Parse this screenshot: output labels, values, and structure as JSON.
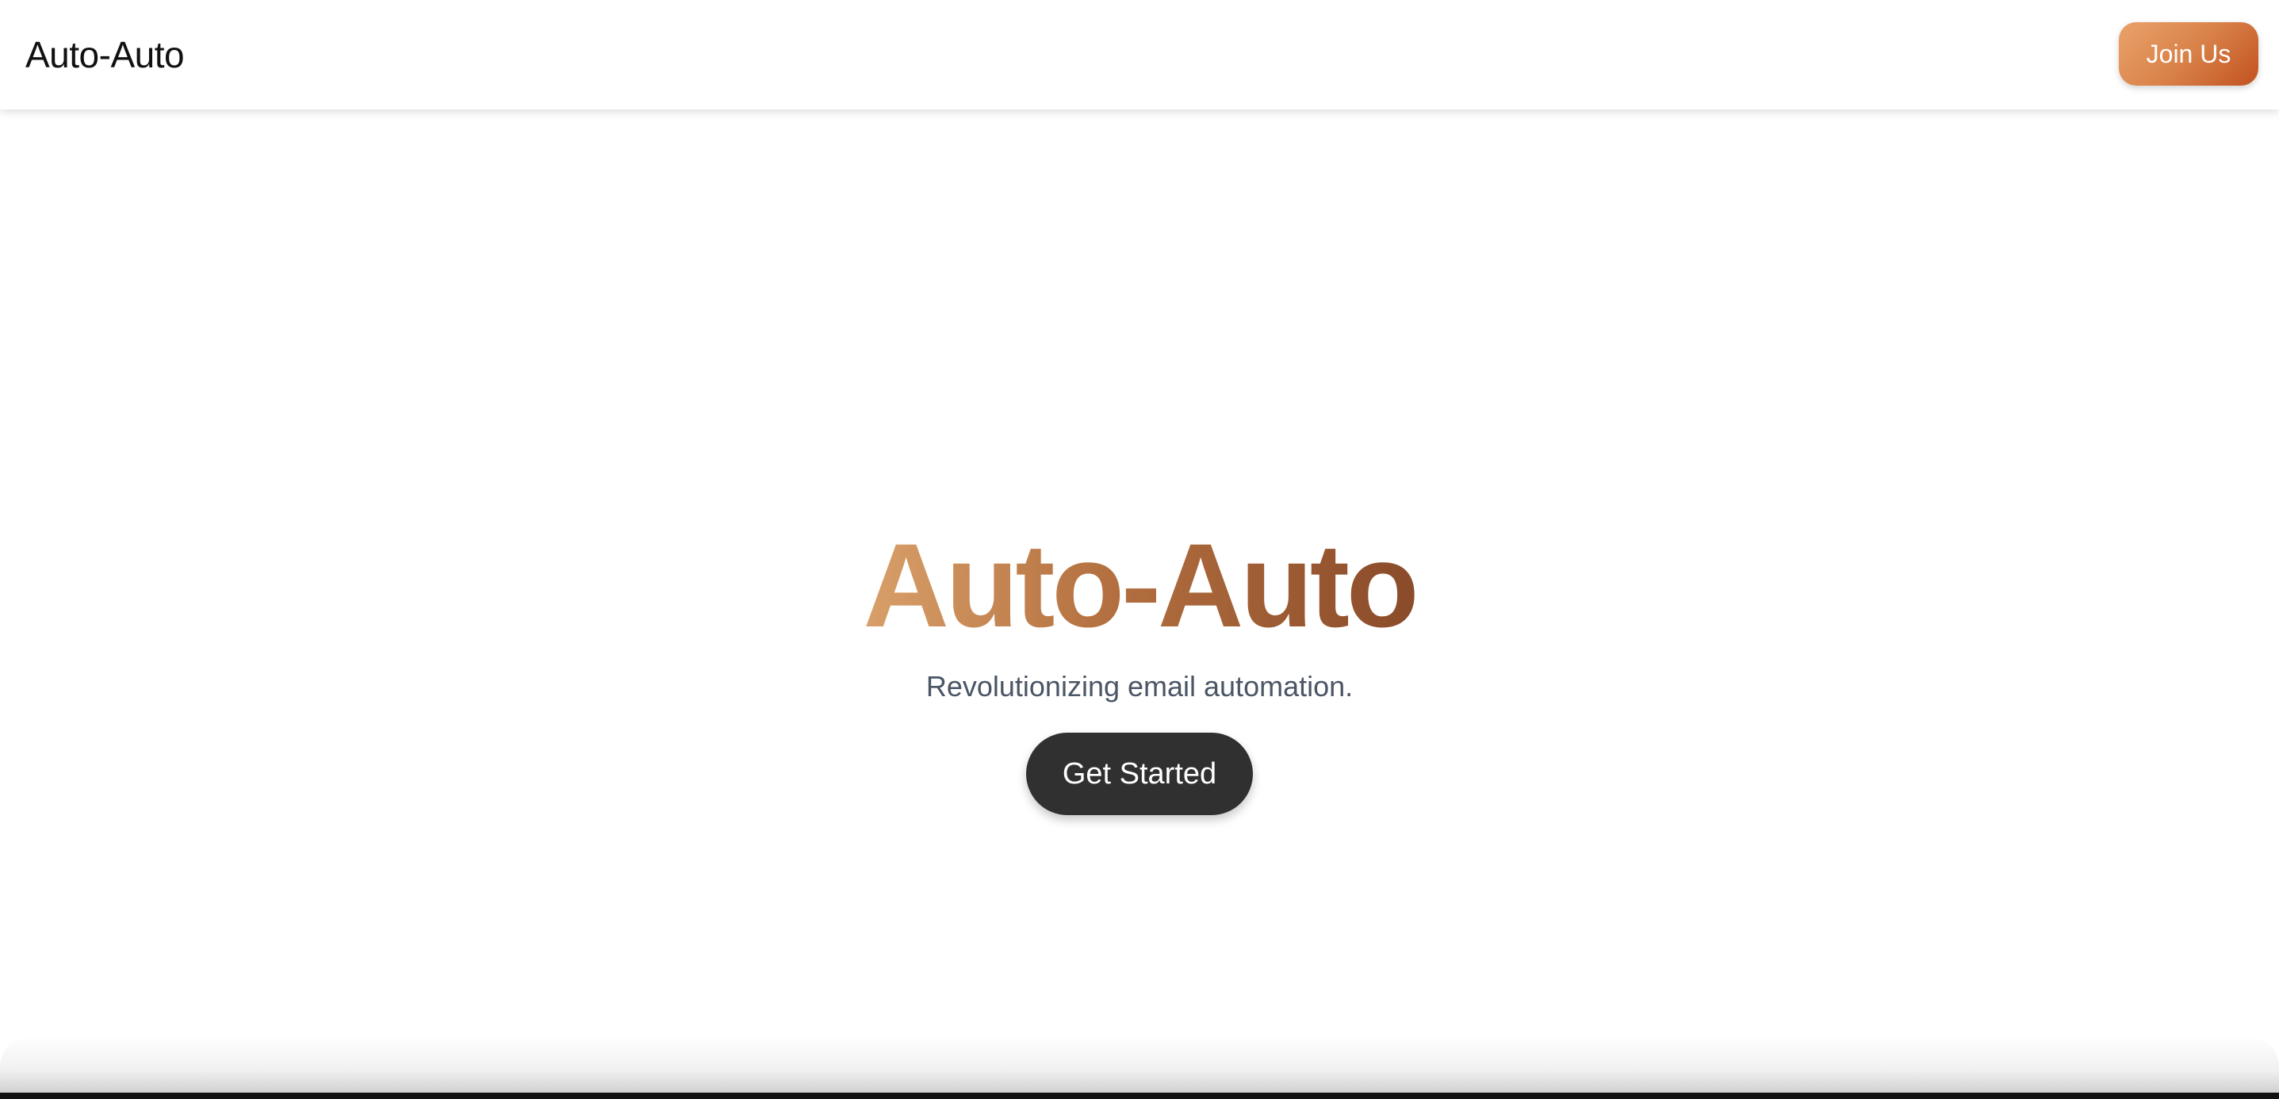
{
  "navbar": {
    "brand": "Auto-Auto",
    "join_label": "Join Us"
  },
  "hero": {
    "title": "Auto-Auto",
    "subtitle": "Revolutionizing email automation.",
    "cta_label": "Get Started"
  },
  "colors": {
    "accent_gradient_start": "#e9a36a",
    "accent_gradient_end": "#c2521f",
    "title_gradient_start": "#d9a06a",
    "title_gradient_end": "#8a4b2a",
    "cta_background": "#303030",
    "subtitle_text": "#4a5565"
  }
}
